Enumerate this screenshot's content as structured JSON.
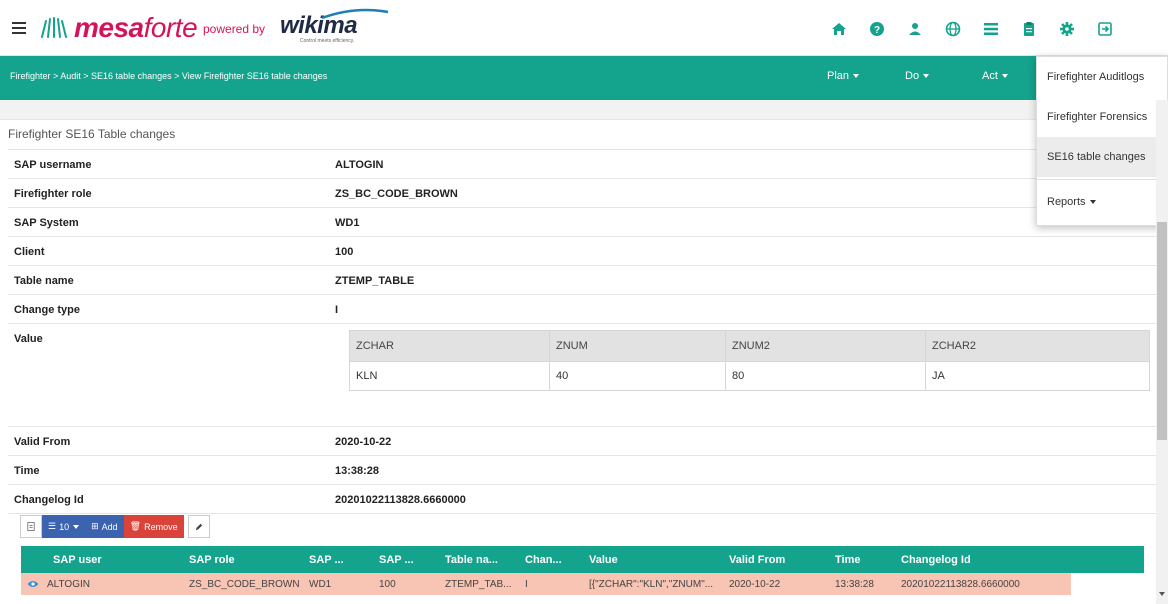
{
  "header": {
    "logo_main": "mesa",
    "logo_rest": "forte",
    "powered_by": "powered by",
    "wiki_logo": "wikima",
    "wiki_tagline": "Control meets efficiency.",
    "icons": [
      "home-icon",
      "help-icon",
      "user-icon",
      "globe-icon",
      "list-icon",
      "clipboard-icon",
      "gear-icon",
      "logout-icon"
    ]
  },
  "navbar": {
    "breadcrumb": "Firefighter > Audit > SE16 table changes > View Firefighter SE16 table changes",
    "menus": [
      "Plan",
      "Do",
      "Act"
    ]
  },
  "dropdown": {
    "items": [
      "Firefighter Auditlogs",
      "Firefighter Forensics",
      "SE16 table changes"
    ],
    "reports": "Reports"
  },
  "section_title": "Firefighter SE16 Table changes",
  "details": [
    {
      "label": "SAP username",
      "value": "ALTOGIN"
    },
    {
      "label": "Firefighter role",
      "value": "ZS_BC_CODE_BROWN"
    },
    {
      "label": "SAP System",
      "value": "WD1"
    },
    {
      "label": "Client",
      "value": "100"
    },
    {
      "label": "Table name",
      "value": "ZTEMP_TABLE"
    },
    {
      "label": "Change type",
      "value": "I"
    }
  ],
  "value_label": "Value",
  "value_table": {
    "headers": [
      "ZCHAR",
      "ZNUM",
      "ZNUM2",
      "ZCHAR2"
    ],
    "row": [
      "KLN",
      "40",
      "80",
      "JA"
    ]
  },
  "details2": [
    {
      "label": "Valid From",
      "value": "2020-10-22"
    },
    {
      "label": "Time",
      "value": "13:38:28"
    },
    {
      "label": "Changelog Id",
      "value": "20201022113828.6660000"
    }
  ],
  "toolbar": {
    "page_size": "10",
    "add": "Add",
    "remove": "Remove"
  },
  "grid": {
    "headers": [
      "SAP user",
      "SAP role",
      "SAP ...",
      "SAP ...",
      "Table na...",
      "Chan...",
      "Value",
      "Valid From",
      "Time",
      "Changelog Id"
    ],
    "row": [
      "ALTOGIN",
      "ZS_BC_CODE_BROWN",
      "WD1",
      "100",
      "ZTEMP_TAB...",
      "I",
      "[{\"ZCHAR\":\"KLN\",\"ZNUM\"...",
      "2020-10-22",
      "13:38:28",
      "20201022113828.6660000"
    ]
  },
  "colors": {
    "brand_green": "#14a38c",
    "logo_magenta": "#d4145a",
    "row_highlight": "#f8c4b4",
    "add_blue": "#3c63b0",
    "remove_red": "#d9433a"
  }
}
